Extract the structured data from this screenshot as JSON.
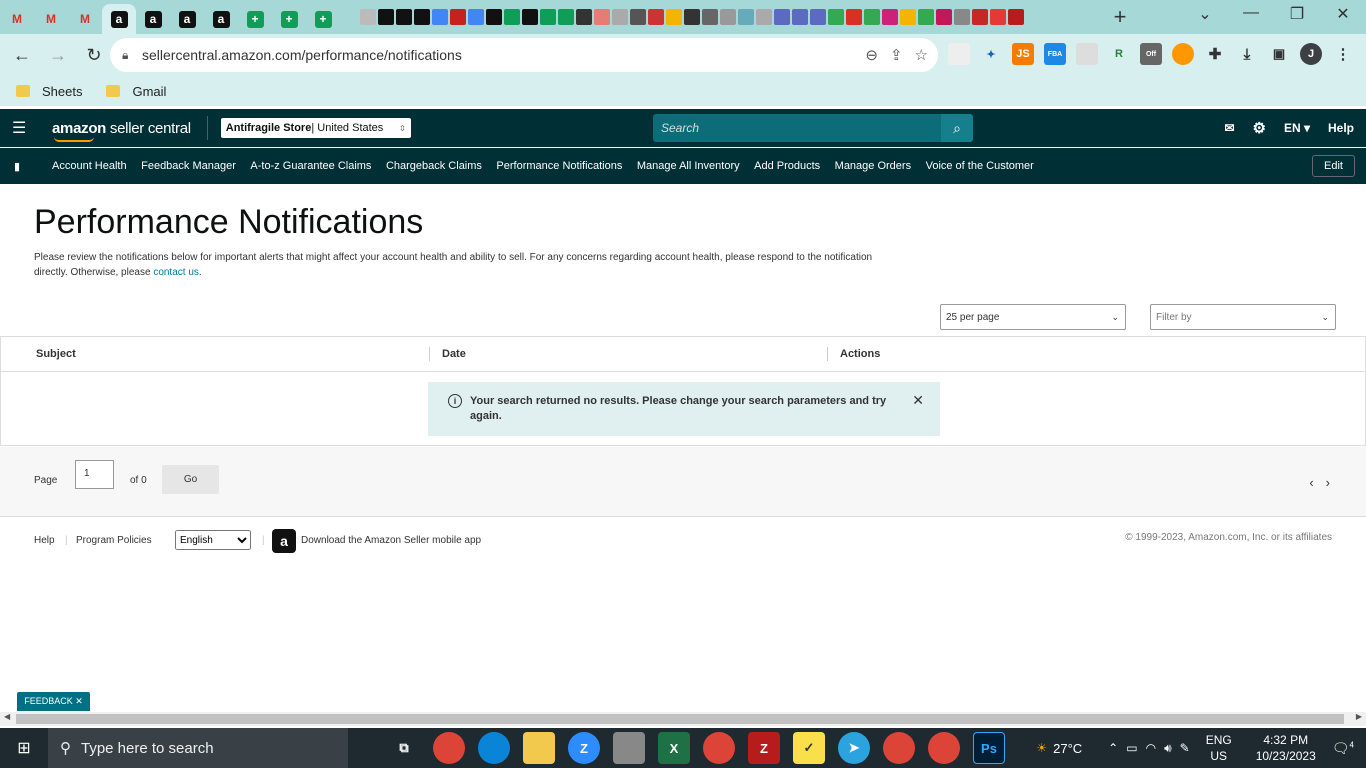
{
  "browser": {
    "tab_letters": [
      "M",
      "M",
      "M",
      "a",
      "a",
      "a",
      "a",
      "+",
      "+",
      "+"
    ],
    "new_tab_label": "+",
    "window_controls": [
      "⌄",
      "—",
      "❐",
      "✕"
    ],
    "url": "sellercentral.amazon.com/performance/notifications",
    "bookmarks": [
      "Sheets",
      "Gmail"
    ],
    "profile_initial": "J",
    "ext_badge": "Off"
  },
  "header": {
    "logo_main": "amazon",
    "logo_sub": " seller central",
    "store_name": "Antifragile Store",
    "store_region": " | United States",
    "search_placeholder": "Search",
    "language": "EN",
    "help": "Help"
  },
  "nav": {
    "items": [
      "Account Health",
      "Feedback Manager",
      "A-to-z Guarantee Claims",
      "Chargeback Claims",
      "Performance Notifications",
      "Manage All Inventory",
      "Add Products",
      "Manage Orders",
      "Voice of the Customer"
    ],
    "edit_label": "Edit"
  },
  "page": {
    "title": "Performance Notifications",
    "intro": "Please review the notifications below for important alerts that might affect your account health and ability to sell. For any concerns regarding account health, please respond to the notification directly. Otherwise, please ",
    "intro_link": "contact us",
    "intro_end": ".",
    "per_page": "25 per page",
    "filter_placeholder": "Filter by"
  },
  "table": {
    "columns": [
      "Subject",
      "Date",
      "Actions"
    ],
    "empty_message": "Your search returned no results. Please change your search parameters and try again."
  },
  "pager": {
    "page_label": "Page",
    "page_value": "1",
    "of_label": "of 0",
    "go_label": "Go"
  },
  "footer": {
    "help": "Help",
    "policies": "Program Policies",
    "language": "English",
    "app_text": "Download the Amazon Seller mobile app",
    "copyright": "© 1999-2023, Amazon.com, Inc. or its affiliates"
  },
  "feedback_label": "FEEDBACK ✕",
  "taskbar": {
    "search_placeholder": "Type here to search",
    "weather": "27°C",
    "lang_line1": "ENG",
    "lang_line2": "US",
    "time": "4:32 PM",
    "date": "10/23/2023",
    "notification_count": "4"
  }
}
